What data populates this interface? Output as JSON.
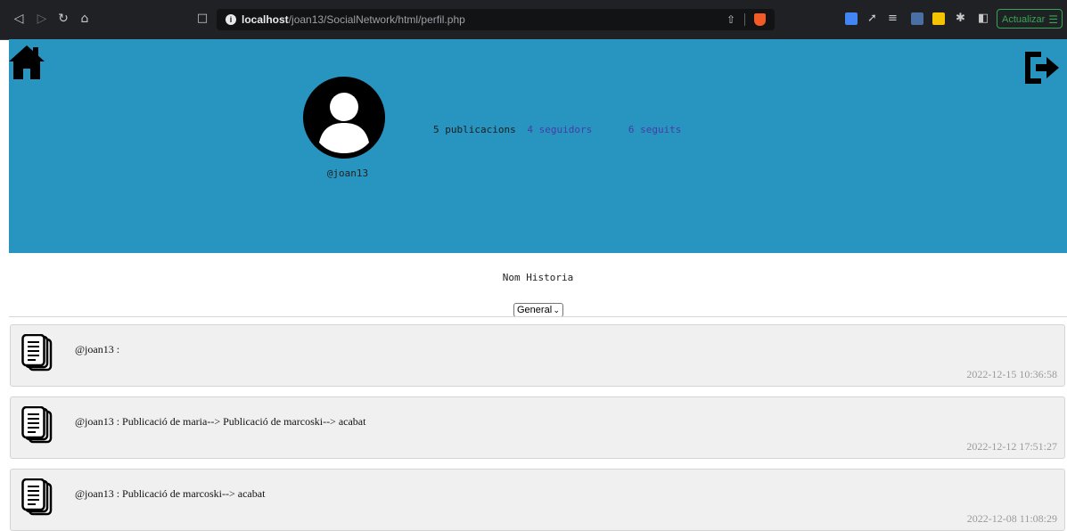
{
  "browser": {
    "url_host": "localhost",
    "url_path": "/joan13/SocialNetwork/html/perfil.php",
    "update_label": "Actualizar"
  },
  "profile": {
    "username": "@joan13",
    "publications": "5 publicacions",
    "followers": "4 seguidors",
    "following": "6 seguits"
  },
  "story": {
    "name": "Nom Historia",
    "filter_selected": "General"
  },
  "posts": [
    {
      "text": "@joan13 :",
      "date": "2022-12-15 10:36:58"
    },
    {
      "text": "@joan13 : Publicació de maria--> Publicació de marcoski--> acabat",
      "date": "2022-12-12 17:51:27"
    },
    {
      "text": "@joan13 : Publicació de marcoski--> acabat",
      "date": "2022-12-08 11:08:29"
    }
  ],
  "colors": {
    "banner": "#2795bf",
    "link": "#4b3aa8",
    "post_bg": "#f0f0f0"
  }
}
